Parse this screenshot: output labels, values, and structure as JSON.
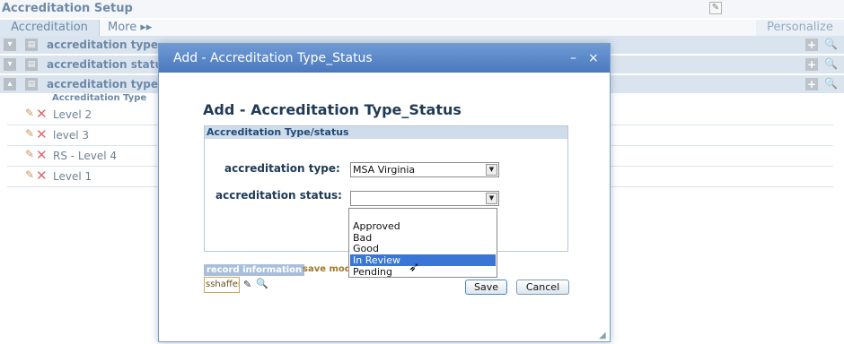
{
  "page": {
    "title": "Accreditation Setup",
    "tabs": [
      "Accreditation",
      "More ▸▸"
    ],
    "personalize": "Personalize"
  },
  "sections": [
    {
      "label": "accreditation type",
      "toggle": "▾"
    },
    {
      "label": "accreditation status",
      "toggle": "▾"
    },
    {
      "label": "accreditation type/s",
      "toggle": "▴"
    }
  ],
  "type_table": {
    "column_header": "Accreditation Type",
    "rows": [
      "Level 2",
      "level 3",
      "RS - Level 4",
      "Level 1"
    ]
  },
  "dialog": {
    "title": "Add - Accreditation Type_Status",
    "minimize": "–",
    "close": "×",
    "heading": "Add - Accreditation Type_Status",
    "panel_header": "Accreditation Type/status",
    "type_label": "accreditation type:",
    "type_value": "MSA Virginia",
    "status_label": "accreditation status:",
    "status_value": "",
    "status_options": [
      "",
      "Approved",
      "Bad",
      "Good",
      "In Review",
      "Pending"
    ],
    "highlighted_option": "In Review",
    "record_info": "record information",
    "save_mode": "save mode",
    "user": "sshaffer",
    "save_label": "Save",
    "cancel_label": "Cancel"
  },
  "icons": {
    "edit": "edit-icon",
    "delete": "delete-icon",
    "search": "search-icon",
    "plus": "plus-icon",
    "cursor": "cursor-icon"
  },
  "colors": {
    "dialog_header": "#4a78bd",
    "section_row": "#c7d6e6",
    "highlight": "#3b76d6",
    "delete_red": "#cc1a1a"
  }
}
